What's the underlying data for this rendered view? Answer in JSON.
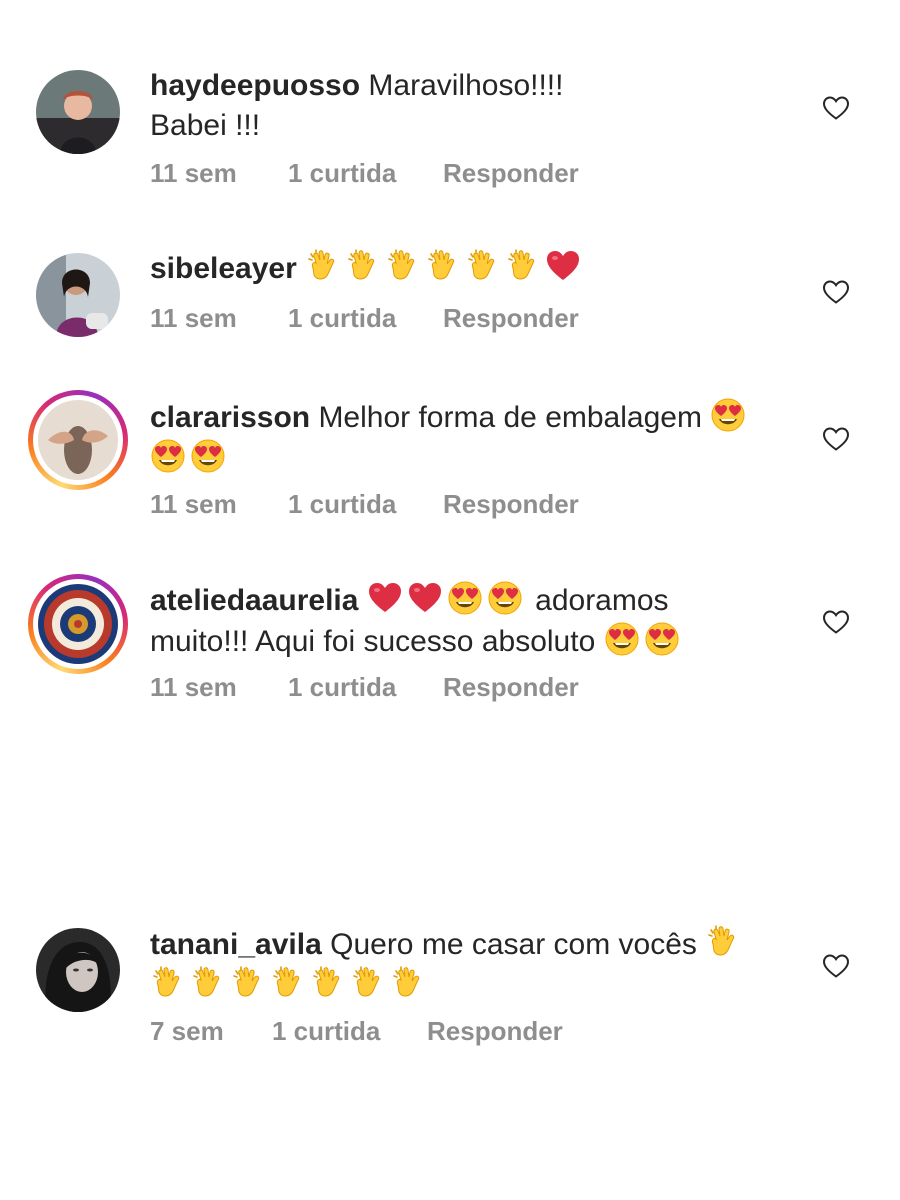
{
  "comments": [
    {
      "username": "haydeepuosso",
      "text_line1": "Maravilhoso!!!!",
      "text_line2": "Babei !!!",
      "time": "11 sem",
      "likes": "1 curtida",
      "reply": "Responder",
      "emojis": []
    },
    {
      "username": "sibeleayer",
      "text": "",
      "time": "11 sem",
      "likes": "1 curtida",
      "reply": "Responder",
      "emojis": [
        "clapping-hands",
        "clapping-hands",
        "clapping-hands",
        "clapping-hands",
        "clapping-hands",
        "clapping-hands",
        "red-heart"
      ]
    },
    {
      "username": "clararisson",
      "text": "Melhor forma de embalagem",
      "time": "11 sem",
      "likes": "1 curtida",
      "reply": "Responder",
      "emojis": [
        "heart-eyes",
        "heart-eyes",
        "heart-eyes"
      ]
    },
    {
      "username": "ateliedaaurelia",
      "text_part1": "adoramos",
      "text_part2": "muito!!! Aqui foi sucesso absoluto",
      "time": "11 sem",
      "likes": "1 curtida",
      "reply": "Responder",
      "emojis": [
        "red-heart",
        "red-heart",
        "heart-eyes",
        "heart-eyes",
        "heart-eyes",
        "heart-eyes"
      ]
    },
    {
      "username": "tanani_avila",
      "text": "Quero me casar com vocês",
      "time": "7 sem",
      "likes": "1 curtida",
      "reply": "Responder",
      "emojis": [
        "clapping-hands",
        "clapping-hands",
        "clapping-hands",
        "clapping-hands",
        "clapping-hands",
        "clapping-hands",
        "clapping-hands",
        "clapping-hands"
      ]
    }
  ],
  "colors": {
    "text": "#262626",
    "meta": "#8e8e8e",
    "story_ring": [
      "#feda75",
      "#fa7e1e",
      "#d62976",
      "#962fbf"
    ]
  }
}
